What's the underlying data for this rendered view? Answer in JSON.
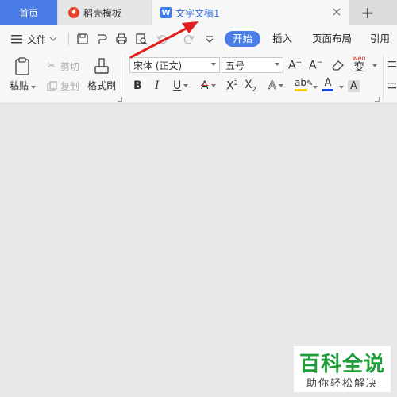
{
  "tabs": {
    "home": "首页",
    "templates": "稻壳模板",
    "document": "文字文稿1",
    "document_badge": "W"
  },
  "menu": {
    "file": "文件",
    "ribbon_tabs": [
      "开始",
      "插入",
      "页面布局",
      "引用"
    ]
  },
  "ribbon": {
    "paste": "粘贴",
    "cut": "剪切",
    "copy": "复制",
    "format_painter": "格式刷",
    "font_name": "宋体 (正文)",
    "font_size": "五号",
    "wen_glyph": "wén",
    "wen_char": "变"
  },
  "watermark": {
    "title": "百科全说",
    "subtitle": "助你轻松解决"
  },
  "colors": {
    "accent": "#4a7ee6",
    "highlight": "#f5d400",
    "font_color": "#1a47d8",
    "annotation": "#e02020",
    "watermark": "#1f9e3a"
  }
}
